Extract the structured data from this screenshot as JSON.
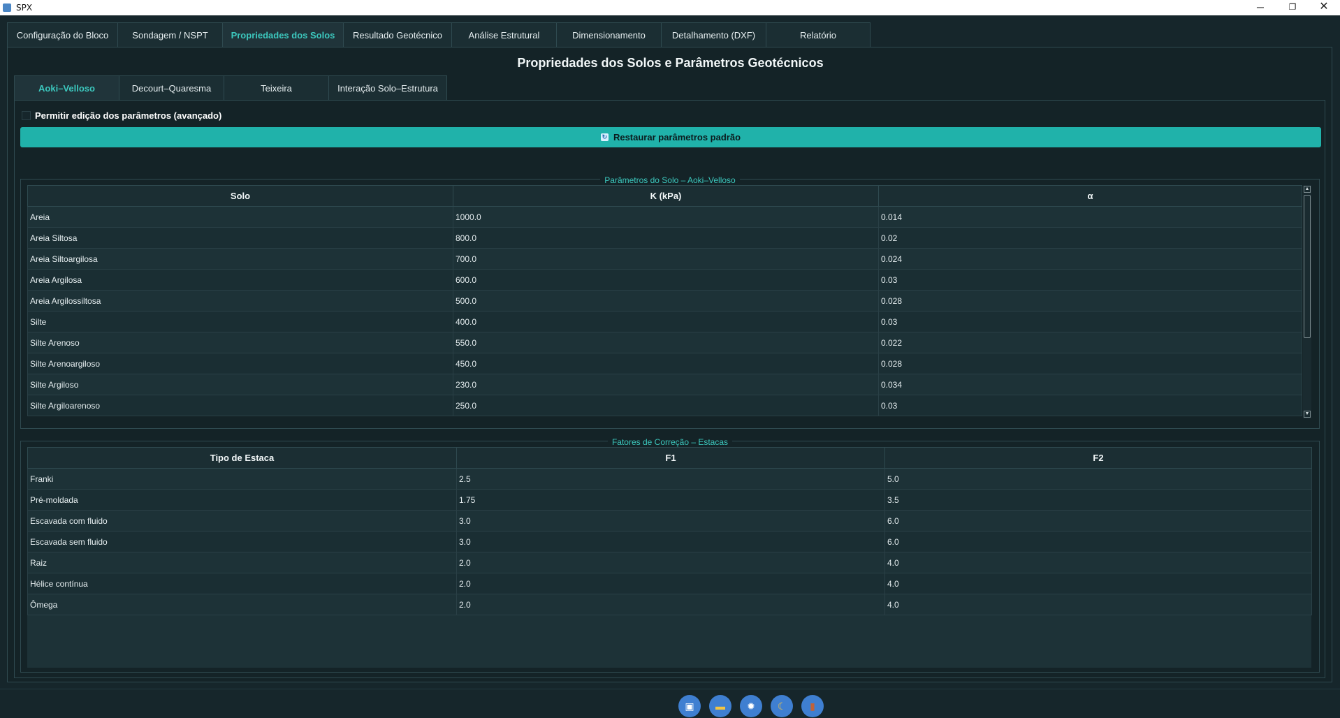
{
  "window": {
    "title": "SPX",
    "minimize_icon": "─",
    "maximize_icon": "❐",
    "close_icon": "✕"
  },
  "main_tabs": [
    {
      "label": "Configuração do Bloco",
      "active": false
    },
    {
      "label": "Sondagem / NSPT",
      "active": false
    },
    {
      "label": "Propriedades dos Solos",
      "active": true
    },
    {
      "label": "Resultado Geotécnico",
      "active": false
    },
    {
      "label": "Análise Estrutural",
      "active": false
    },
    {
      "label": "Dimensionamento",
      "active": false
    },
    {
      "label": "Detalhamento (DXF)",
      "active": false
    },
    {
      "label": "Relatório",
      "active": false
    }
  ],
  "page": {
    "title": "Propriedades dos Solos e Parâmetros Geotécnicos"
  },
  "sub_tabs": [
    {
      "label": "Aoki–Velloso",
      "active": true
    },
    {
      "label": "Decourt–Quaresma",
      "active": false
    },
    {
      "label": "Teixeira",
      "active": false
    },
    {
      "label": "Interação Solo–Estrutura",
      "active": false
    }
  ],
  "edit_checkbox": {
    "label": "Permitir edição dos parâmetros (avançado)",
    "checked": false
  },
  "restore_button": {
    "label": "Restaurar parâmetros padrão",
    "icon": "↻"
  },
  "soil_group": {
    "title": "Parâmetros do Solo – Aoki–Velloso",
    "headers": [
      "Solo",
      "K (kPa)",
      "α"
    ],
    "rows": [
      [
        "Areia",
        "1000.0",
        "0.014"
      ],
      [
        "Areia Siltosa",
        "800.0",
        "0.02"
      ],
      [
        "Areia Siltoargilosa",
        "700.0",
        "0.024"
      ],
      [
        "Areia Argilosa",
        "600.0",
        "0.03"
      ],
      [
        "Areia Argilossiltosa",
        "500.0",
        "0.028"
      ],
      [
        "Silte",
        "400.0",
        "0.03"
      ],
      [
        "Silte Arenoso",
        "550.0",
        "0.022"
      ],
      [
        "Silte Arenoargiloso",
        "450.0",
        "0.028"
      ],
      [
        "Silte Argiloso",
        "230.0",
        "0.034"
      ],
      [
        "Silte Argiloarenoso",
        "250.0",
        "0.03"
      ]
    ],
    "scroll_up": "▲",
    "scroll_down": "▼"
  },
  "factor_group": {
    "title": "Fatores de Correção – Estacas",
    "headers": [
      "Tipo de Estaca",
      "F1",
      "F2"
    ],
    "rows": [
      [
        "Franki",
        "2.5",
        "5.0"
      ],
      [
        "Pré-moldada",
        "1.75",
        "3.5"
      ],
      [
        "Escavada com fluido",
        "3.0",
        "6.0"
      ],
      [
        "Escavada sem fluido",
        "3.0",
        "6.0"
      ],
      [
        "Raiz",
        "2.0",
        "4.0"
      ],
      [
        "Hélice contínua",
        "2.0",
        "4.0"
      ],
      [
        "Ômega",
        "2.0",
        "4.0"
      ]
    ]
  },
  "toolbar": [
    {
      "name": "save-icon",
      "glyph": "▣"
    },
    {
      "name": "folder-icon",
      "glyph": "▬"
    },
    {
      "name": "gear-icon",
      "glyph": "✹"
    },
    {
      "name": "moon-icon",
      "glyph": "☾"
    },
    {
      "name": "exit-icon",
      "glyph": "▮"
    }
  ],
  "colors": {
    "accent": "#20b2aa",
    "active_tab_text": "#3cc8be",
    "background": "#16262b",
    "button_blue": "#3f7fd1"
  }
}
